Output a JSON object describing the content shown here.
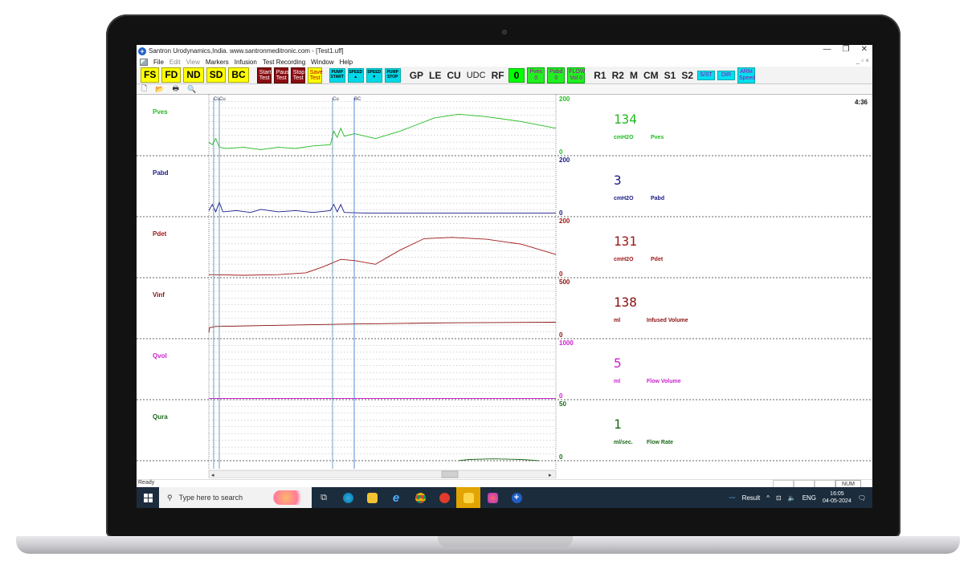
{
  "window": {
    "title": "Santron Urodynamics,India. www.santronmeditronic.com  - [Test1.uff]",
    "min": "—",
    "max": "❐",
    "close": "✕",
    "mdi_ctrls": "_  ▫  ×"
  },
  "menu": [
    "File",
    "Edit",
    "View",
    "Markers",
    "Infusion",
    "Test Recording",
    "Window",
    "Help"
  ],
  "toolbar": {
    "fs": "FS",
    "fd": "FD",
    "nd": "ND",
    "sd": "SD",
    "bc": "BC",
    "start_test": "Start Test",
    "pause_test": "Pause Test",
    "stop_test": "Stop Test",
    "save_test": "Save Test",
    "pump_start": "PUMP START",
    "speed_up": "SPEED ▲",
    "speed_down": "SPEED ▼",
    "pump_stop": "PUMP STOP",
    "gp": "GP",
    "le": "LE",
    "cu": "CU",
    "udc": "UDC",
    "rf": "RF",
    "rf_value": "0",
    "pves_btn": "Pves 0",
    "pabd_btn": "Pabd 0",
    "flow_btn": "FLOW Vol 0",
    "r1": "R1",
    "r2": "R2",
    "m": "M",
    "cm": "CM",
    "s1": "S1",
    "s2": "S2",
    "sst": "S/ST",
    "dir": "DIR",
    "arm_speed": "ARM Speed"
  },
  "elapsed_time": "4:36",
  "markers": {
    "cl": "CL",
    "cu1": "Cu",
    "cu2": "Cu",
    "bc": "BC"
  },
  "channels": [
    {
      "label": "Pves",
      "value": "134",
      "unit": "cmH2O",
      "name": "Pves",
      "scale_max": "200",
      "scale_min": "0",
      "color": "#22bb22"
    },
    {
      "label": "Pabd",
      "value": "3",
      "unit": "cmH2O",
      "name": "Pabd",
      "scale_max": "200",
      "scale_min": "0",
      "color": "#1a1a8a"
    },
    {
      "label": "Pdet",
      "value": "131",
      "unit": "cmH2O",
      "name": "Pdet",
      "scale_max": "200",
      "scale_min": "0",
      "color": "#a01818"
    },
    {
      "label": "Vinf",
      "value": "138",
      "unit": "ml",
      "name": "Infused Volume",
      "scale_max": "500",
      "scale_min": "0",
      "color": "#8a1010"
    },
    {
      "label": "Qvol",
      "value": "5",
      "unit": "ml",
      "name": "Flow Volume",
      "scale_max": "1000",
      "scale_min": "0",
      "color": "#cc22cc"
    },
    {
      "label": "Qura",
      "value": "1",
      "unit": "ml/sec.",
      "name": "Flow Rate",
      "scale_max": "50",
      "scale_min": "0",
      "color": "#1a6a1a"
    }
  ],
  "status": {
    "text": "Ready",
    "num": "NUM"
  },
  "taskbar": {
    "search_placeholder": "Type here to search",
    "result": "Result",
    "lang": "ENG",
    "time": "16:05",
    "date": "04-05-2024"
  },
  "colors": {
    "accent_blue": "#1f5fc7",
    "toolbar_yellow": "#ffff00",
    "toolbar_red": "#8b0d12",
    "toolbar_cyan": "#00d8e8",
    "taskbar": "#1b2c3d"
  }
}
